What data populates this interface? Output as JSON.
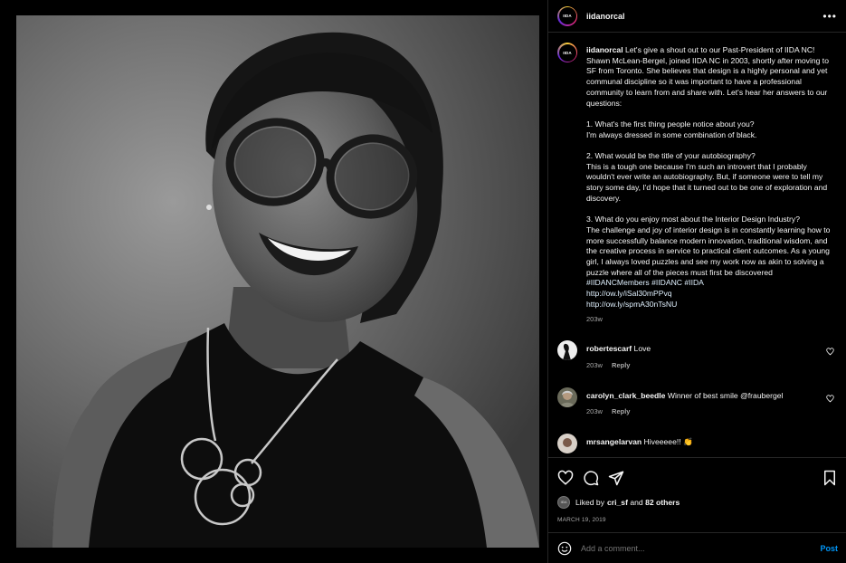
{
  "post": {
    "username": "iidanorcal",
    "avatar_logo": "IIDA",
    "more_label": "•••",
    "caption_user": "iidanorcal",
    "caption_text": "Let's give a shout out to our Past-President of IIDA NC! Shawn McLean-Bergel, joined IIDA NC in 2003, shortly after moving to SF from Toronto. She believes that design is a highly personal and yet communal discipline so it was important to have a professional community to learn from and share with. Let's hear her answers to our questions:\n\n1. What's the first thing people notice about you?\nI'm always dressed in some combination of black.\n\n2. What would be the title of your autobiography?\nThis is a tough one because I'm such an introvert that I probably wouldn't ever write an autobiography. But, if someone were to tell my story some day, I'd hope that it turned out to be one of exploration and discovery.\n\n3. What do you enjoy most about the Interior Design Industry?\nThe challenge and joy of interior design is in constantly learning how to more successfully balance modern innovation, traditional wisdom, and the creative process in service to practical client outcomes. As a young girl, I always loved puzzles and see my work now as akin to solving a puzzle where all of the pieces must first be discovered\n",
    "tags": "#IIDANCMembers #IIDANC #IIDA",
    "link1": "http://ow.ly/iSal30mPPvq",
    "link2": "http://ow.ly/spmA30nTsNU",
    "caption_time": "203w"
  },
  "comments": [
    {
      "user": "robertescarf",
      "text": "Love",
      "time": "203w",
      "reply": "Reply"
    },
    {
      "user": "carolyn_clark_beedle",
      "text": "Winner of best smile @fraubergel",
      "time": "203w",
      "reply": "Reply"
    },
    {
      "user": "mrsangelarvan",
      "text": "Hiveeeee!! 👏",
      "time": "",
      "reply": ""
    }
  ],
  "likes": {
    "prefix": "Liked by ",
    "user": "cri_sf",
    "mid": " and ",
    "count": "82 others"
  },
  "date": "MARCH 19, 2019",
  "add_comment": {
    "placeholder": "Add a comment...",
    "post_label": "Post"
  },
  "icons": [
    "heart-icon",
    "comment-icon",
    "share-icon",
    "bookmark-icon",
    "emoji-icon"
  ]
}
